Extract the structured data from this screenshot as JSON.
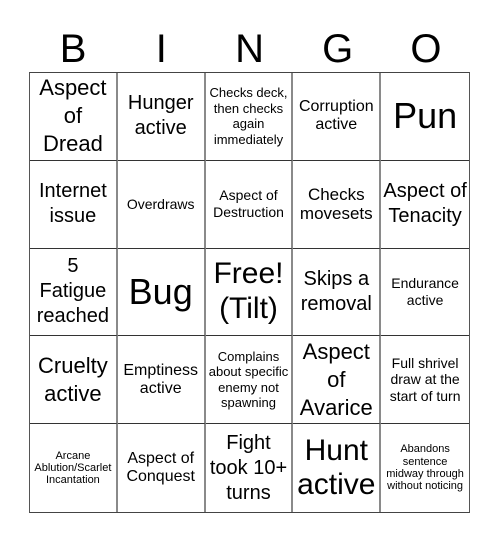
{
  "header": {
    "letters": [
      "B",
      "I",
      "N",
      "G",
      "O"
    ]
  },
  "cells": [
    [
      "Aspect of Dread",
      "Hunger active",
      "Checks deck, then checks again immediately",
      "Corruption active",
      "Pun"
    ],
    [
      "Internet issue",
      "Overdraws",
      "Aspect of Destruction",
      "Checks movesets",
      "Aspect of Tenacity"
    ],
    [
      "5 Fatigue reached",
      "Bug",
      "Free! (Tilt)",
      "Skips a removal",
      "Endurance active"
    ],
    [
      "Cruelty active",
      "Emptiness active",
      "Complains about specific enemy not spawning",
      "Aspect of Avarice",
      "Full shrivel draw at the start of turn"
    ],
    [
      "Arcane Ablution/Scarlet Incantation",
      "Aspect of Conquest",
      "Fight took 10+ turns",
      "Hunt active",
      "Abandons sentence midway through without noticing"
    ]
  ]
}
